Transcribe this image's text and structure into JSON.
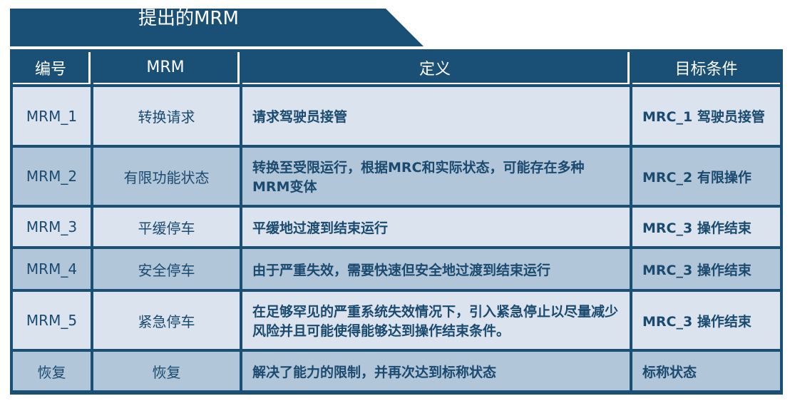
{
  "title": "提出的MRM",
  "headers": [
    "编号",
    "MRM",
    "定义",
    "目标条件"
  ],
  "rows": [
    {
      "id": "MRM_1",
      "mrm": "转换请求",
      "definition": "请求驾驶员接管",
      "target": "MRC_1 驾驶员接管"
    },
    {
      "id": "MRM_2",
      "mrm": "有限功能状态",
      "definition": "转换至受限运行，根据MRC和实际状态，可能存在多种MRM变体",
      "target": "MRC_2 有限操作"
    },
    {
      "id": "MRM_3",
      "mrm": "平缓停车",
      "definition": "平缓地过渡到结束运行",
      "target": "MRC_3 操作结束"
    },
    {
      "id": "MRM_4",
      "mrm": "安全停车",
      "definition": "由于严重失效，需要快速但安全地过渡到结束运行",
      "target": "MRC_3 操作结束"
    },
    {
      "id": "MRM_5",
      "mrm": "紧急停车",
      "definition": "在足够罕见的严重系统失效情况下，引入紧急停止以尽量减少风险并且可能使得能够达到操作结束条件。",
      "target": "MRC_3 操作结束"
    },
    {
      "id": "恢复",
      "mrm": "恢复",
      "definition": "解决了能力的限制，并再次达到标称状态",
      "target": "标称状态"
    }
  ],
  "colors": {
    "header": "#1b5076",
    "row_light": "#dbe4ee",
    "row_dark": "#b2c6da",
    "text": "#1b4a6f"
  }
}
